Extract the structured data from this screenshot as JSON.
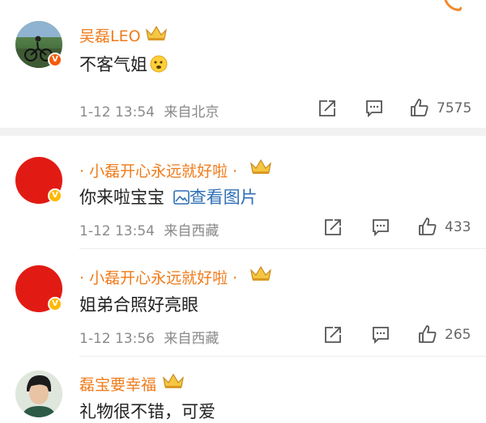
{
  "comments": [
    {
      "author": "吴磊LEO",
      "text": "不客气姐",
      "timestamp": "1-12 13:54",
      "location": "来自北京",
      "like_count": "7575"
    },
    {
      "author": "· 小磊开心永远就好啦 ·",
      "text": "你来啦宝宝",
      "link_text": "查看图片",
      "timestamp": "1-12 13:54",
      "location": "来自西藏",
      "like_count": "433"
    },
    {
      "author": "· 小磊开心永远就好啦 ·",
      "text": "姐弟合照好亮眼",
      "timestamp": "1-12 13:56",
      "location": "来自西藏",
      "like_count": "265"
    },
    {
      "author": "磊宝要幸福",
      "text": "礼物很不错，可爱"
    }
  ],
  "colors": {
    "name": "#f07b1a",
    "link": "#2f6fb5",
    "avatar_red": "#e11b14",
    "verified_orange": "#f45b0b",
    "verified_yellow": "#ffb800"
  },
  "icons": [
    "share-icon",
    "comment-icon",
    "like-icon",
    "crown-badge-icon",
    "verified-badge-icon",
    "emoji-icon",
    "image-link-icon"
  ]
}
